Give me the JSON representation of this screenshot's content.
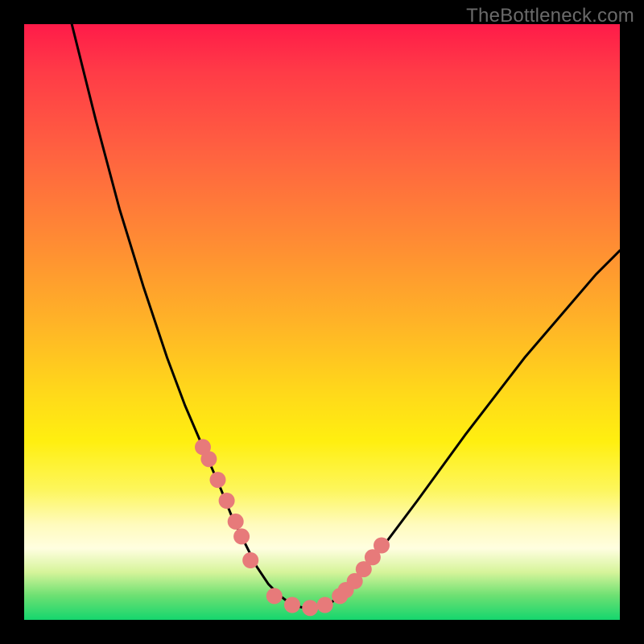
{
  "watermark": "TheBottleneck.com",
  "chart_data": {
    "type": "line",
    "title": "",
    "xlabel": "",
    "ylabel": "",
    "xlim": [
      0,
      100
    ],
    "ylim": [
      0,
      100
    ],
    "series": [
      {
        "name": "bottleneck-curve",
        "x": [
          8,
          12,
          16,
          20,
          24,
          27,
          30,
          33,
          35,
          37,
          39,
          41,
          43,
          45,
          47,
          49,
          51,
          53,
          56,
          60,
          66,
          74,
          84,
          96,
          100
        ],
        "values": [
          100,
          84,
          69,
          56,
          44,
          36,
          29,
          22,
          17,
          13,
          9,
          6,
          4,
          2.5,
          2,
          2,
          2.5,
          4,
          7,
          12,
          20,
          31,
          44,
          58,
          62
        ]
      }
    ],
    "markers": {
      "name": "data-points",
      "x": [
        30,
        31,
        32.5,
        34,
        35.5,
        36.5,
        38,
        42,
        45,
        48,
        50.5,
        53,
        54,
        55.5,
        57,
        58.5,
        60
      ],
      "values": [
        29,
        27,
        23.5,
        20,
        16.5,
        14,
        10,
        4,
        2.5,
        2,
        2.5,
        4,
        5,
        6.5,
        8.5,
        10.5,
        12.5
      ],
      "color": "#e77a7a",
      "radius": 10
    },
    "colors": {
      "curve_stroke": "#000000",
      "marker_fill": "#e77a7a",
      "gradient_top": "#ff1b49",
      "gradient_bottom": "#15d66e"
    }
  }
}
